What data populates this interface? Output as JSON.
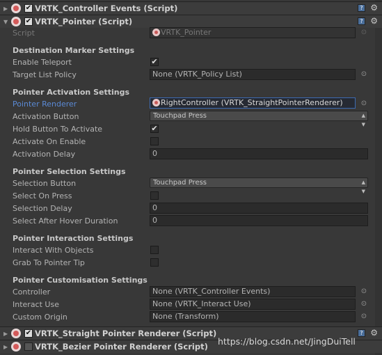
{
  "components": {
    "controller_events": {
      "title": "VRTK_Controller Events (Script)",
      "enabled": true
    },
    "pointer": {
      "title": "VRTK_Pointer (Script)",
      "enabled": true
    },
    "straight_renderer": {
      "title": "VRTK_Straight Pointer Renderer (Script)",
      "enabled": true
    },
    "bezier_renderer": {
      "title": "VRTK_Bezier Pointer Renderer (Script)",
      "enabled": false
    }
  },
  "script": {
    "label": "Script",
    "value": "VRTK_Pointer"
  },
  "destination": {
    "heading": "Destination Marker Settings",
    "enable_teleport": {
      "label": "Enable Teleport",
      "checked": true
    },
    "target_list_policy": {
      "label": "Target List Policy",
      "value": "None (VRTK_Policy List)"
    }
  },
  "activation": {
    "heading": "Pointer Activation Settings",
    "pointer_renderer": {
      "label": "Pointer Renderer",
      "value": "RightController (VRTK_StraightPointerRenderer)"
    },
    "activation_button": {
      "label": "Activation Button",
      "value": "Touchpad Press"
    },
    "hold_button": {
      "label": "Hold Button To Activate",
      "checked": true
    },
    "activate_on_enable": {
      "label": "Activate On Enable",
      "checked": false
    },
    "activation_delay": {
      "label": "Activation Delay",
      "value": "0"
    }
  },
  "selection": {
    "heading": "Pointer Selection Settings",
    "selection_button": {
      "label": "Selection Button",
      "value": "Touchpad Press"
    },
    "select_on_press": {
      "label": "Select On Press",
      "checked": false
    },
    "selection_delay": {
      "label": "Selection Delay",
      "value": "0"
    },
    "select_after_hover": {
      "label": "Select After Hover Duration",
      "value": "0"
    }
  },
  "interaction": {
    "heading": "Pointer Interaction Settings",
    "interact_with_objects": {
      "label": "Interact With Objects",
      "checked": false
    },
    "grab_to_pointer_tip": {
      "label": "Grab To Pointer Tip",
      "checked": false
    }
  },
  "customisation": {
    "heading": "Pointer Customisation Settings",
    "controller": {
      "label": "Controller",
      "value": "None (VRTK_Controller Events)"
    },
    "interact_use": {
      "label": "Interact Use",
      "value": "None (VRTK_Interact Use)"
    },
    "custom_origin": {
      "label": "Custom Origin",
      "value": "None (Transform)"
    }
  },
  "icons": {
    "check": "✔",
    "help": "?",
    "gear": "⚙",
    "object_picker": "⊙",
    "fold_open": "▼",
    "fold_closed": "▶",
    "dropdown_arrow": "▲▼"
  },
  "watermark": "https://blog.csdn.net/JingDuiTell"
}
